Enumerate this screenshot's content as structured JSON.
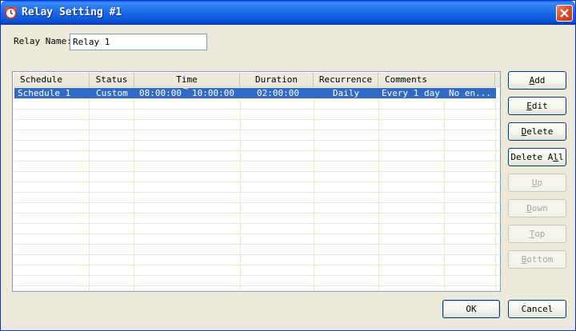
{
  "window": {
    "title": "Relay Setting #1",
    "colors": {
      "titlebar": "#0a4fd6",
      "selection": "#316ac5",
      "face": "#ece9d8"
    }
  },
  "form": {
    "relay_name_label": "Relay Name:",
    "relay_name_value": "Relay 1"
  },
  "table": {
    "columns": [
      "Schedule",
      "Status",
      "Time",
      "Duration",
      "Recurrence",
      "Comments"
    ],
    "rows": [
      {
        "schedule": "Schedule 1",
        "status": "Custom",
        "time_start": "08:00:00",
        "time_sep": "~",
        "time_end": "10:00:00",
        "duration": "02:00:00",
        "recurrence": "Daily",
        "comments": "Every 1 day",
        "extra": "No en..."
      }
    ]
  },
  "buttons": {
    "add": {
      "pre": "",
      "key": "A",
      "post": "dd"
    },
    "edit": {
      "pre": "",
      "key": "E",
      "post": "dit"
    },
    "delete": {
      "pre": "",
      "key": "D",
      "post": "elete"
    },
    "delete_all": {
      "pre": "Delete A",
      "key": "l",
      "post": "l"
    },
    "up": {
      "pre": "",
      "key": "U",
      "post": "p"
    },
    "down": {
      "pre": "",
      "key": "D",
      "post": "own"
    },
    "top": {
      "pre": "",
      "key": "T",
      "post": "op"
    },
    "bottom": {
      "pre": "",
      "key": "B",
      "post": "ottom"
    },
    "ok": "OK",
    "cancel": "Cancel"
  }
}
